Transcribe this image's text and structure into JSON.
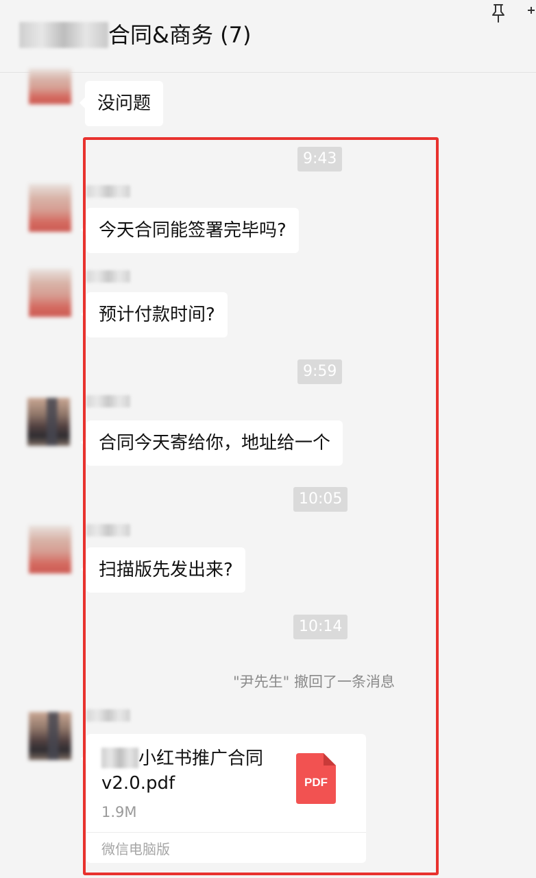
{
  "header": {
    "title": "合同&商务 (7)",
    "pin_icon": "pin-icon",
    "more_icon": "more-icon"
  },
  "messages": [
    {
      "text": "没问题"
    },
    {
      "time": "9:43"
    },
    {
      "text": "今天合同能签署完毕吗?"
    },
    {
      "text": "预计付款时间?"
    },
    {
      "time": "9:59"
    },
    {
      "text": "合同今天寄给你，地址给一个"
    },
    {
      "time": "10:05"
    },
    {
      "text": "扫描版先发出来?"
    },
    {
      "time": "10:14"
    },
    {
      "system": "\"尹先生\" 撤回了一条消息"
    }
  ],
  "file": {
    "name_line1": "小红书推广合同",
    "name_line2": "v2.0.pdf",
    "size": "1.9M",
    "type_label": "PDF",
    "source": "微信电脑版"
  },
  "colors": {
    "background": "#f4f4f4",
    "bubble": "#ffffff",
    "highlight": "#e8322e",
    "pdf": "#f25251"
  }
}
